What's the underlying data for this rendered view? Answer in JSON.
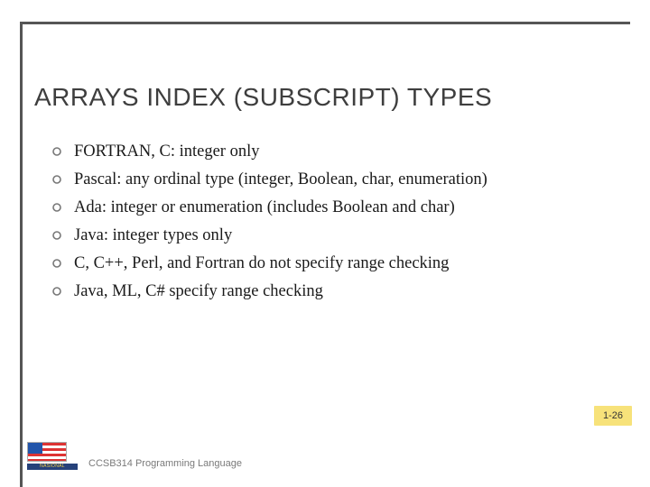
{
  "title": "ARRAYS INDEX (SUBSCRIPT) TYPES",
  "bullets": [
    "FORTRAN, C: integer only",
    "Pascal: any ordinal type (integer, Boolean, char, enumeration)",
    "Ada: integer or enumeration (includes Boolean and char)",
    "Java: integer types only",
    "C, C++, Perl, and Fortran do not specify range checking",
    "Java, ML, C# specify range checking"
  ],
  "page_number": "1-26",
  "footer": "CCSB314 Programming Language",
  "logo_band": "NASIONAL"
}
